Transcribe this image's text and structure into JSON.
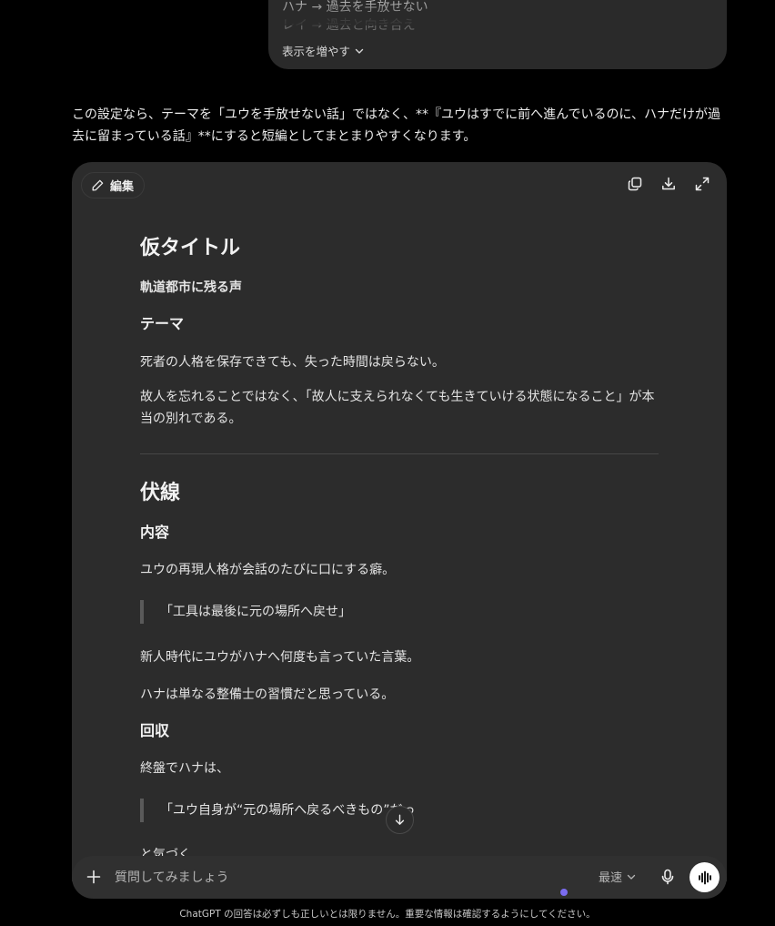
{
  "top_bubble": {
    "line1": "ハナ → 過去を手放せない",
    "line2": "レイ → 過去と向き合え",
    "show_more_label": "表示を増やす"
  },
  "assistant": {
    "paragraph": "この設定なら、テーマを「ユウを手放せない話」ではなく、**『ユウはすでに前へ進んでいるのに、ハナだけが過去に留まっている話』**にすると短編としてまとまりやすくなります。"
  },
  "canvas": {
    "edit_label": "編集",
    "tools": {
      "copy_icon": "copy-icon",
      "download_icon": "download-icon",
      "expand_icon": "expand-icon"
    },
    "doc": {
      "title_heading": "仮タイトル",
      "title_value": "軌道都市に残る声",
      "theme_heading": "テーマ",
      "theme_p1": "死者の人格を保存できても、失った時間は戻らない。",
      "theme_p2": "故人を忘れることではなく、「故人に支えられなくても生きていける状態になること」が本当の別れである。",
      "foreshadow_heading": "伏線",
      "content_heading": "内容",
      "content_p1": "ユウの再現人格が会話のたびに口にする癖。",
      "content_quote": "「工具は最後に元の場所へ戻せ」",
      "content_p2": "新人時代にユウがハナへ何度も言っていた言葉。",
      "content_p3": "ハナは単なる整備士の習慣だと思っている。",
      "payoff_heading": "回収",
      "payoff_p1": "終盤でハナは、",
      "payoff_quote": "「ユウ自身が“元の場所へ戻るべきもの”だっ",
      "payoff_cut": "と気づく"
    }
  },
  "composer": {
    "placeholder": "質問してみましょう",
    "model_label": "最速"
  },
  "footer": {
    "disclaimer": "ChatGPT の回答は必ずしも正しいとは限りません。重要な情報は確認するようにしてください。"
  },
  "colors": {
    "background": "#000000",
    "card": "#2c2c2c",
    "composer": "#303030",
    "accent_dot": "#7b6cf0"
  }
}
